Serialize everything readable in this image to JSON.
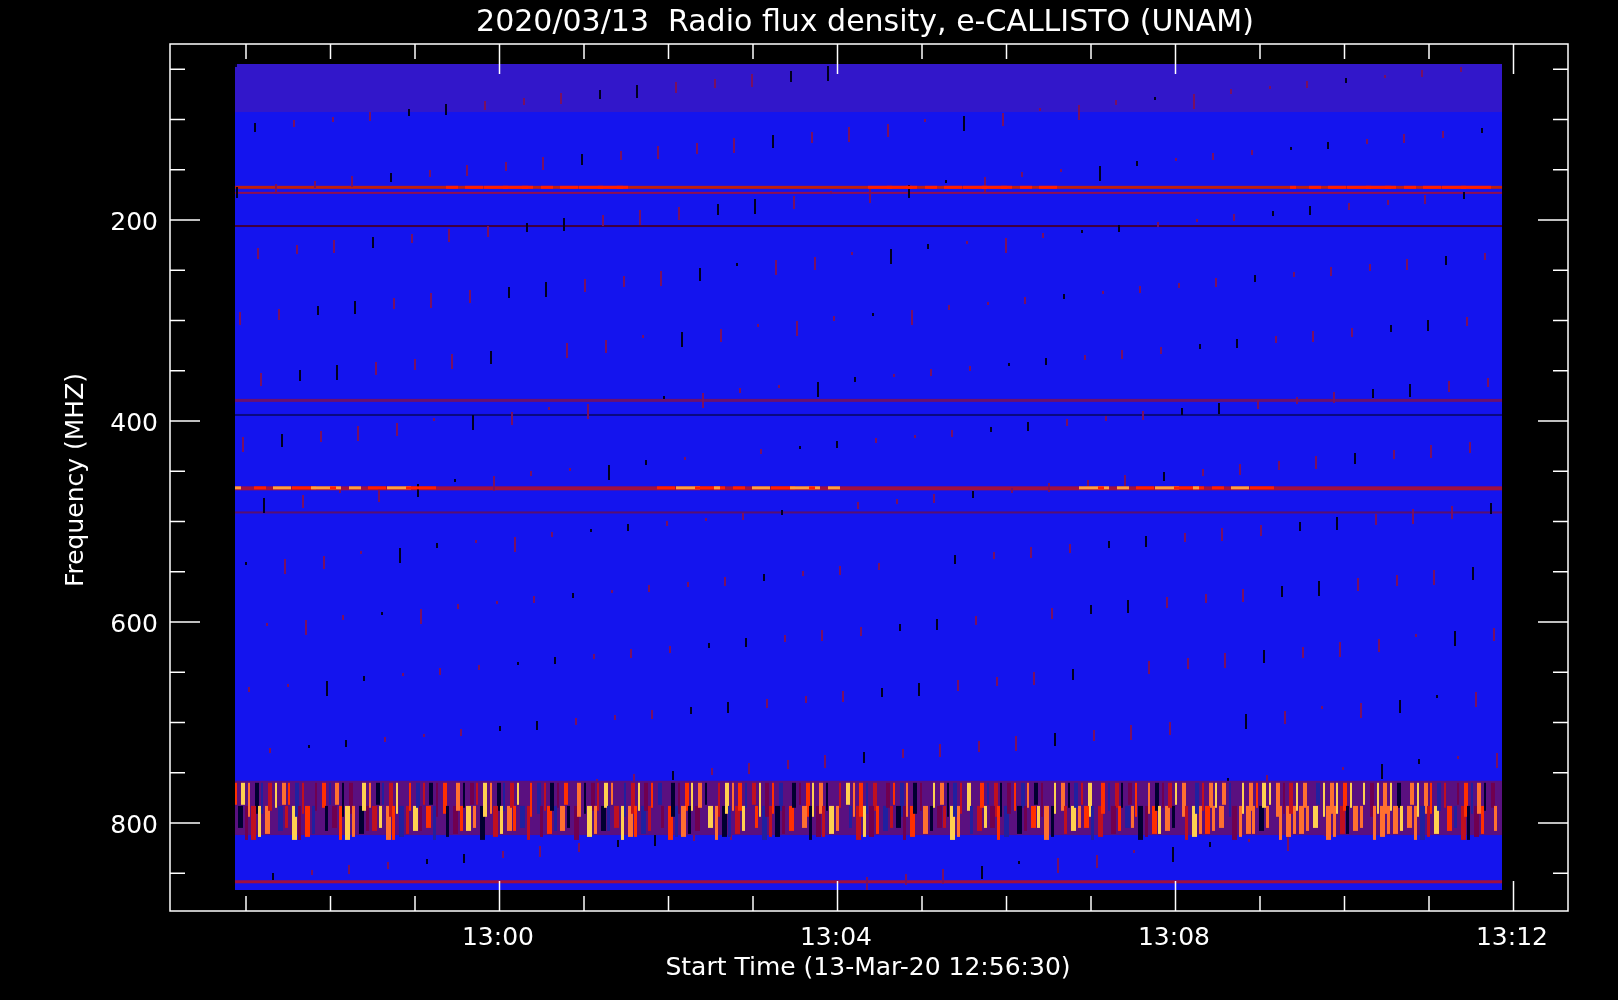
{
  "title": "2020/03/13  Radio flux density, e-CALLISTO (UNAM)",
  "y_axis": {
    "label": "Frequency (MHZ)",
    "ticks": [
      "200",
      "400",
      "600",
      "800"
    ]
  },
  "x_axis": {
    "label": "Start Time (13-Mar-20 12:56:30)",
    "ticks": [
      "13:00",
      "13:04",
      "13:08",
      "13:12"
    ]
  }
}
